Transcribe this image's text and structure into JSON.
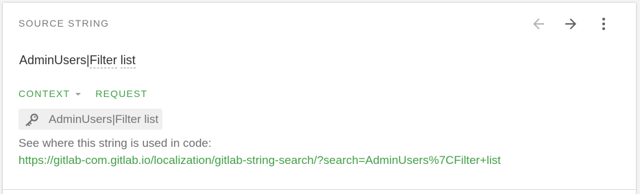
{
  "panel": {
    "title": "SOURCE STRING"
  },
  "nav": {
    "prev_icon": "arrow-left-icon",
    "next_icon": "arrow-right-icon",
    "more_icon": "more-vertical-icon",
    "prev_color": "#b5b5b5",
    "next_color": "#616161"
  },
  "source": {
    "part1": "AdminUsers",
    "separator": "|",
    "word1": "Filter",
    "word2": "list"
  },
  "tabs": [
    {
      "label": "CONTEXT",
      "has_dropdown": true
    },
    {
      "label": "REQUEST",
      "has_dropdown": false
    }
  ],
  "key": {
    "icon": "key-icon",
    "value": "AdminUsers|Filter list"
  },
  "code_hint": {
    "text": "See where this string is used in code:",
    "link": "https://gitlab-com.gitlab.io/localization/gitlab-string-search/?search=AdminUsers%7CFilter+list"
  },
  "colors": {
    "accent": "#43a047",
    "muted": "#757575"
  }
}
